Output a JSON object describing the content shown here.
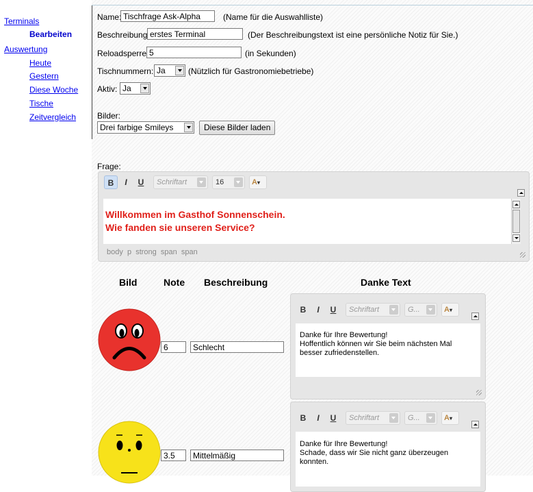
{
  "sidebar": {
    "terminals": "Terminals",
    "bearbeiten": "Bearbeiten",
    "auswertung": "Auswertung",
    "heute": "Heute",
    "gestern": "Gestern",
    "diese_woche": "Diese Woche",
    "tische": "Tische",
    "zeitvergleich": "Zeitvergleich"
  },
  "form": {
    "name_label": "Name:",
    "name_value": "Tischfrage Ask-Alpha",
    "name_hint": "(Name für die Auswahlliste)",
    "desc_label": "Beschreibung:",
    "desc_value": "erstes Terminal",
    "desc_hint": "(Der Beschreibungstext ist eine persönliche Notiz für Sie.)",
    "reload_label": "Reloadsperre:",
    "reload_value": "5",
    "reload_hint": "(in Sekunden)",
    "table_label": "Tischnummern:",
    "table_value": "Ja",
    "table_hint": "(Nützlich für Gastronomiebetriebe)",
    "active_label": "Aktiv:",
    "active_value": "Ja",
    "images_label": "Bilder:",
    "images_value": "Drei farbige Smileys",
    "load_button": "Diese Bilder laden",
    "question_label": "Frage:"
  },
  "main_editor": {
    "font_placeholder": "Schriftart",
    "size_value": "16",
    "line1": "Willkommen im Gasthof Sonnenschein.",
    "line2": "Wie fanden sie unseren Service?",
    "path": "body  p  strong  span  span",
    "text_color": "#e0201a"
  },
  "table": {
    "col_bild": "Bild",
    "col_note": "Note",
    "col_beschreibung": "Beschreibung",
    "col_danke": "Danke Text"
  },
  "rows": [
    {
      "note": "6",
      "beschreibung": "Schlecht",
      "danke_lines": [
        "Danke für Ihre Bewertung!",
        "Hoffentlich können wir Sie beim nächsten Mal",
        "besser zufriedenstellen."
      ],
      "font_placeholder": "Schriftart",
      "size_placeholder": "G...",
      "smiley_color": "#e8322d"
    },
    {
      "note": "3.5",
      "beschreibung": "Mittelmäßig",
      "danke_lines": [
        "Danke für Ihre Bewertung!",
        "Schade, dass wir Sie nicht ganz überzeugen",
        "konnten."
      ],
      "font_placeholder": "Schriftart",
      "size_placeholder": "G...",
      "smiley_color": "#f7e21a"
    }
  ]
}
